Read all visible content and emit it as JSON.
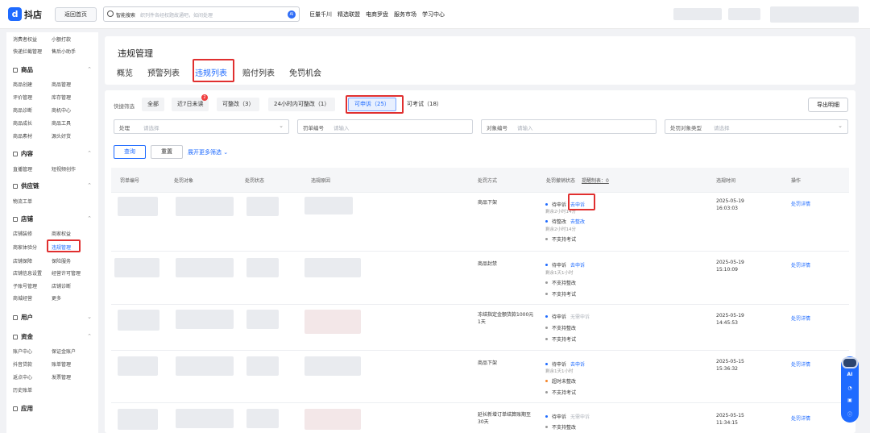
{
  "topbar": {
    "logo_text": "抖店",
    "home_button": "返回首页",
    "search_label": "智能搜索",
    "search_placeholder": "织列件各经权题故通吧，如间处理",
    "search_ai": "AI",
    "nav": [
      "巨量千川",
      "精选联盟",
      "电商罗盘",
      "服务市场",
      "学习中心"
    ]
  },
  "sidebar": {
    "top_items": [
      [
        "消费者权益",
        "小额打款"
      ],
      [
        "快递拦截管理",
        "售后小助手"
      ]
    ],
    "sections": [
      {
        "title": "商品",
        "items": [
          [
            "商品创建",
            "商品管理"
          ],
          [
            "评价管理",
            "库存管理"
          ],
          [
            "商品诊断",
            "商机中心"
          ],
          [
            "商品成长",
            "商品工具"
          ],
          [
            "商品素材",
            "源头好货"
          ]
        ]
      },
      {
        "title": "内容",
        "items": [
          [
            "直播管理",
            "短视频创作"
          ]
        ]
      },
      {
        "title": "供应链",
        "items": [
          [
            "物流工单",
            ""
          ]
        ]
      },
      {
        "title": "店铺",
        "items": [
          [
            "店铺装修",
            "商家权益"
          ],
          [
            "商家体验分",
            "违规管理"
          ],
          [
            "店铺保障",
            "保险服务"
          ],
          [
            "店铺信息设置",
            "经营许可管理"
          ],
          [
            "子账号管理",
            "店铺诊断"
          ],
          [
            "商城经营",
            "更多"
          ]
        ]
      },
      {
        "title": "用户",
        "items": []
      },
      {
        "title": "资金",
        "items": [
          [
            "账户中心",
            "保证金账户"
          ],
          [
            "抖音贷款",
            "账单管理"
          ],
          [
            "返点中心",
            "发票管理"
          ],
          [
            "历史账单",
            ""
          ]
        ]
      },
      {
        "title": "应用",
        "items": []
      }
    ]
  },
  "page": {
    "title": "违规管理",
    "tabs": [
      "概览",
      "预警列表",
      "违规列表",
      "赔付列表",
      "免罚机会"
    ],
    "active_tab": "违规列表"
  },
  "filters": {
    "quick_label": "快捷筛选",
    "chips": [
      "全部",
      "近7日未读",
      "可整改（3）",
      "24小时内可整改（1）",
      "可申诉（25）",
      "可考试（18）"
    ],
    "unread_badge": "2",
    "export_button": "导出明细",
    "fields": [
      {
        "label": "处理",
        "placeholder": "请选择"
      },
      {
        "label": "罚单编号",
        "placeholder": "请输入"
      },
      {
        "label": "对象编号",
        "placeholder": "请输入"
      },
      {
        "label": "处罚对象类型",
        "placeholder": "请选择"
      }
    ],
    "query_button": "查询",
    "reset_button": "重置",
    "expand_link": "展开更多筛选"
  },
  "table": {
    "headers": [
      "罚单编号",
      "处罚对象",
      "处罚状态",
      "违规原因",
      "处罚方式",
      "处罚撤销状态",
      "提醒制表：0",
      "违规时间",
      "操作"
    ],
    "rows": [
      {
        "method": "商品下架",
        "statuses": [
          {
            "text": "待申诉",
            "link": "去申诉",
            "sub": "剩余2小时14分",
            "dot": "blue"
          },
          {
            "text": "待整改",
            "link": "去整改",
            "sub": "剩余2小时14分",
            "dot": "blue"
          },
          {
            "text": "不支持考试",
            "link": "",
            "sub": "",
            "dot": "grey"
          }
        ],
        "date": "2025-05-19",
        "time": "16:03:03",
        "action": "处罚详情"
      },
      {
        "method": "商品封禁",
        "statuses": [
          {
            "text": "待申诉",
            "link": "去申诉",
            "sub": "剩余1天1小时",
            "dot": "blue"
          },
          {
            "text": "不支持整改",
            "link": "",
            "sub": "",
            "dot": "grey"
          },
          {
            "text": "不支持考试",
            "link": "",
            "sub": "",
            "dot": "grey"
          }
        ],
        "date": "2025-05-19",
        "time": "15:10:09",
        "action": "处罚详情"
      },
      {
        "method": "冻结指定金额货款1000元1天",
        "statuses": [
          {
            "text": "待申诉",
            "link": "无需申诉",
            "sub": "",
            "dot": "blue",
            "muted": true
          },
          {
            "text": "不支持整改",
            "link": "",
            "sub": "",
            "dot": "grey"
          },
          {
            "text": "不支持考试",
            "link": "",
            "sub": "",
            "dot": "grey"
          }
        ],
        "date": "2025-05-19",
        "time": "14:45:53",
        "action": "处罚详情"
      },
      {
        "method": "商品下架",
        "statuses": [
          {
            "text": "待申诉",
            "link": "去申诉",
            "sub": "剩余1天1小时",
            "dot": "blue"
          },
          {
            "text": "超时未整改",
            "link": "",
            "sub": "",
            "dot": "orange"
          },
          {
            "text": "不支持考试",
            "link": "",
            "sub": "",
            "dot": "grey"
          }
        ],
        "date": "2025-05-15",
        "time": "15:36:32",
        "action": "处罚详情"
      },
      {
        "method": "延长新增订单结算账期至30天",
        "statuses": [
          {
            "text": "待申诉",
            "link": "无需申诉",
            "sub": "",
            "dot": "blue",
            "muted": true
          },
          {
            "text": "不支持整改",
            "link": "",
            "sub": "",
            "dot": "grey"
          }
        ],
        "date": "2025-05-15",
        "time": "11:34:15",
        "action": "处罚详情"
      }
    ]
  },
  "side_widget": {
    "ai_label": "AI"
  }
}
